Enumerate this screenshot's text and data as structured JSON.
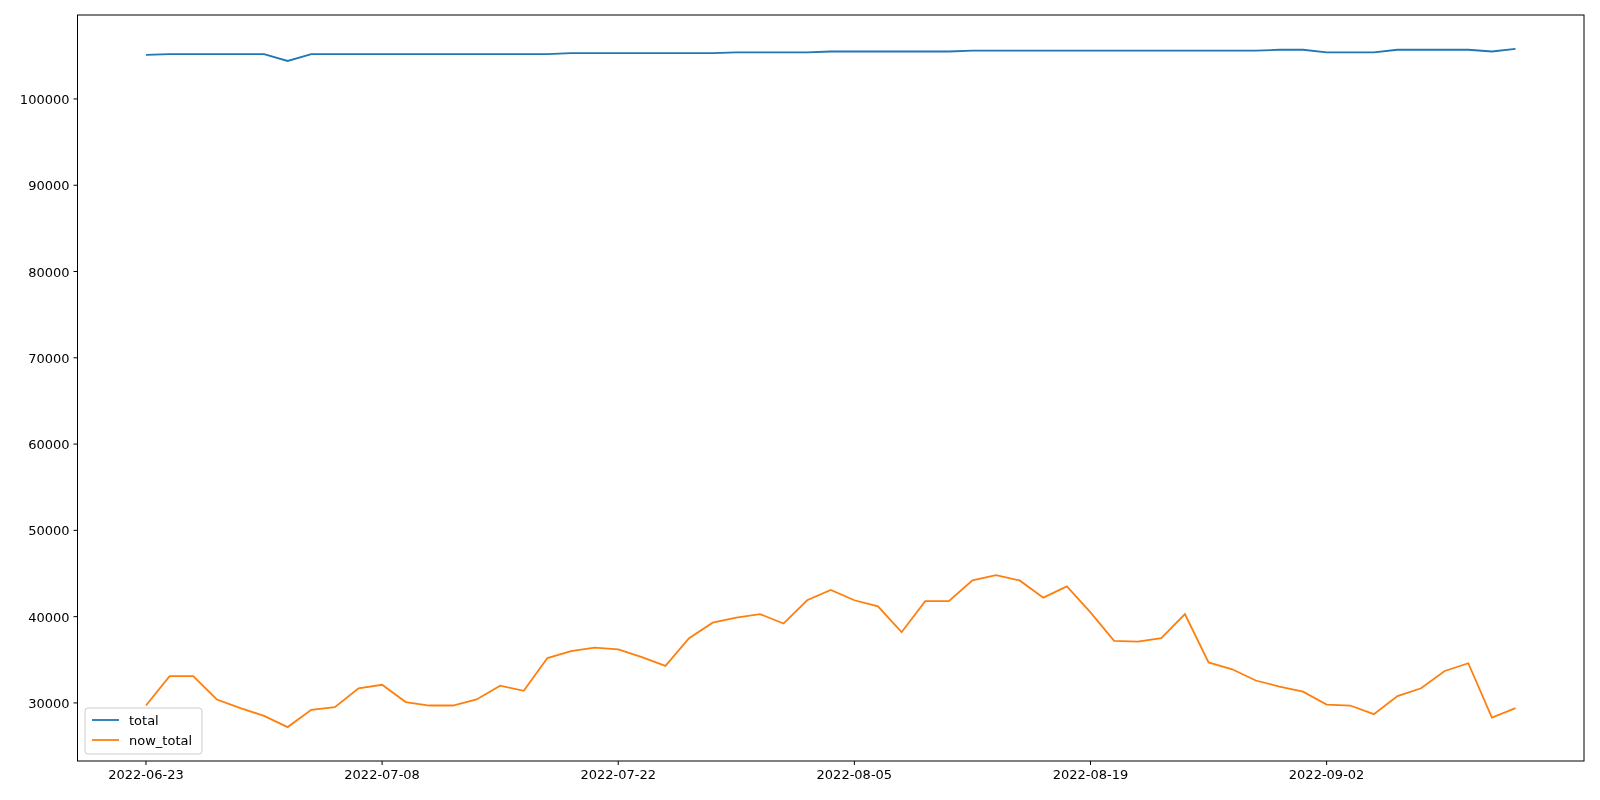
{
  "figure": {
    "chart_data": {
      "type": "line",
      "categories": [
        "2022-06-23",
        null,
        null,
        null,
        null,
        null,
        null,
        null,
        null,
        null,
        "2022-07-08",
        null,
        null,
        null,
        null,
        null,
        null,
        null,
        null,
        null,
        "2022-07-22",
        null,
        null,
        null,
        null,
        null,
        null,
        null,
        null,
        null,
        "2022-08-05",
        null,
        null,
        null,
        null,
        null,
        null,
        null,
        null,
        null,
        "2022-08-19",
        null,
        null,
        null,
        null,
        null,
        null,
        null,
        null,
        null,
        "2022-09-02",
        null,
        null,
        null,
        null,
        null,
        null,
        null,
        null
      ],
      "series": [
        {
          "name": "total",
          "color": "#1f77b4",
          "values": [
            105100,
            105200,
            105200,
            105200,
            105200,
            105200,
            104400,
            105200,
            105200,
            105200,
            105200,
            105200,
            105200,
            105200,
            105200,
            105200,
            105200,
            105200,
            105300,
            105300,
            105300,
            105300,
            105300,
            105300,
            105300,
            105400,
            105400,
            105400,
            105400,
            105500,
            105500,
            105500,
            105500,
            105500,
            105500,
            105600,
            105600,
            105600,
            105600,
            105600,
            105600,
            105600,
            105600,
            105600,
            105600,
            105600,
            105600,
            105600,
            105700,
            105700,
            105400,
            105400,
            105400,
            105700,
            105700,
            105700,
            105700,
            105500,
            105800
          ]
        },
        {
          "name": "now_total",
          "color": "#ff7f0e",
          "values": [
            29700,
            33100,
            33100,
            30400,
            29400,
            28500,
            27200,
            29200,
            29500,
            31700,
            32100,
            30100,
            29700,
            29700,
            30400,
            32000,
            31400,
            35200,
            36000,
            36400,
            36200,
            35300,
            34300,
            37500,
            39300,
            39900,
            40300,
            39200,
            41900,
            43100,
            41900,
            41200,
            38200,
            41800,
            41800,
            44200,
            44800,
            44200,
            42200,
            43500,
            40500,
            37200,
            37100,
            37500,
            40300,
            34700,
            33900,
            32600,
            31900,
            31300,
            29800,
            29700,
            28700,
            30800,
            31700,
            33700,
            34600,
            28300,
            29400
          ]
        }
      ],
      "legend": "lower left",
      "ylim": [
        23270,
        109730
      ],
      "yticks": [
        30000,
        40000,
        50000,
        60000,
        70000,
        80000,
        90000,
        100000
      ]
    }
  }
}
